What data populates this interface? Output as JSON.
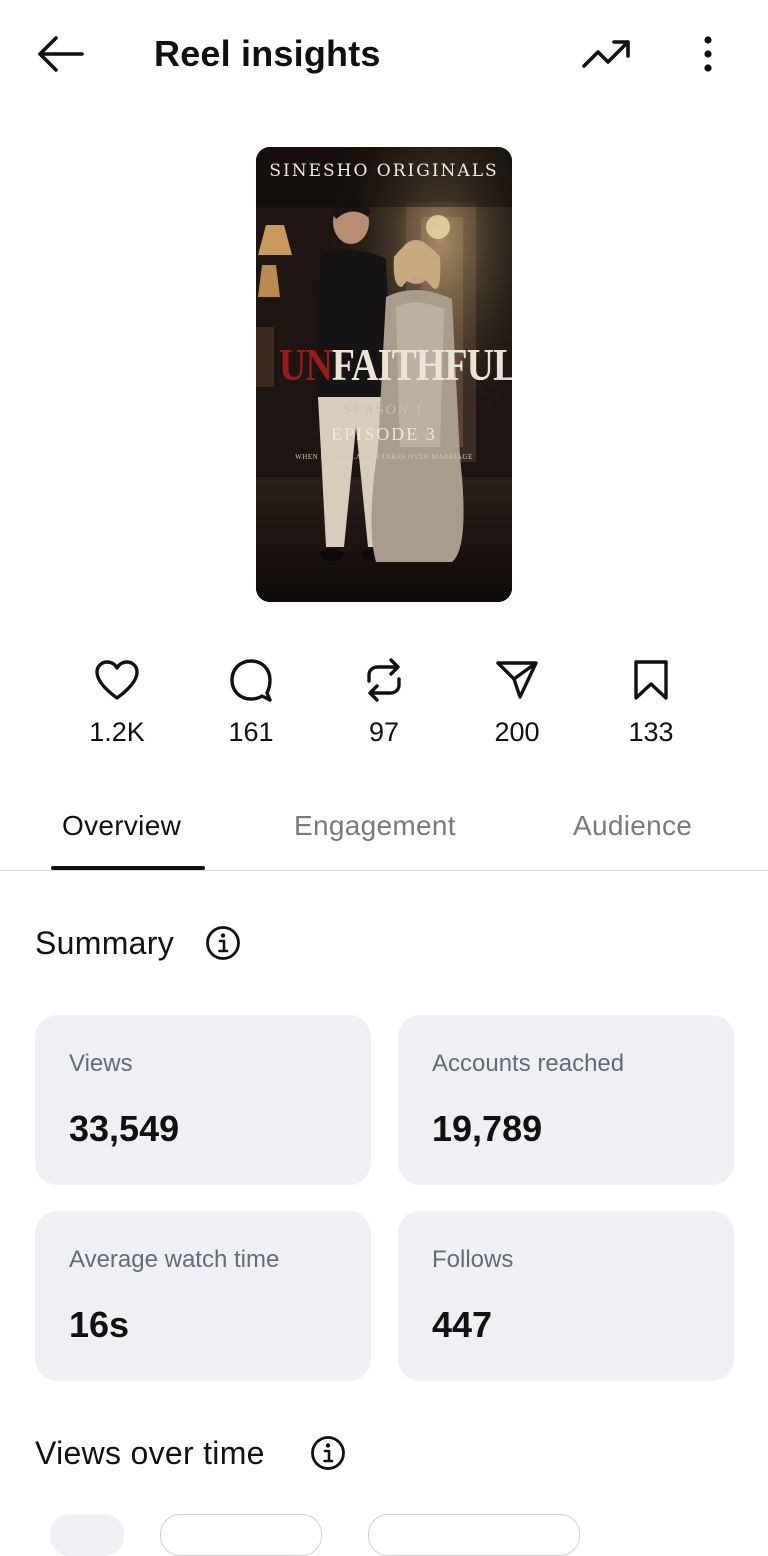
{
  "header": {
    "title": "Reel insights",
    "back_icon": "arrow-left-icon",
    "trend_icon": "trending-up-icon",
    "more_icon": "more-vertical-icon"
  },
  "poster": {
    "brand": "SINESHO ORIGINALS",
    "title_accent": "UN",
    "title_rest": "FAITHFUL",
    "season": "SEASON 1",
    "episode": "EPISODE 3",
    "tagline": "WHEN MANIPULATION TAKES OVER MARRIAGE"
  },
  "stats": [
    {
      "icon": "heart-icon",
      "count": "1.2K"
    },
    {
      "icon": "comment-icon",
      "count": "161"
    },
    {
      "icon": "repost-icon",
      "count": "97"
    },
    {
      "icon": "share-icon",
      "count": "200"
    },
    {
      "icon": "bookmark-icon",
      "count": "133"
    }
  ],
  "tabs": [
    {
      "label": "Overview",
      "active": true
    },
    {
      "label": "Engagement",
      "active": false
    },
    {
      "label": "Audience",
      "active": false
    }
  ],
  "summary": {
    "title": "Summary",
    "cards": [
      {
        "label": "Views",
        "value": "33,549"
      },
      {
        "label": "Accounts reached",
        "value": "19,789"
      },
      {
        "label": "Average watch time",
        "value": "16s"
      },
      {
        "label": "Follows",
        "value": "447"
      }
    ]
  },
  "views_over_time": {
    "title": "Views over time"
  },
  "colors": {
    "card_bg": "#eff0f4",
    "muted_text": "#666a73",
    "tab_inactive": "#7a7a7a",
    "poster_accent": "#9b1a1c"
  }
}
